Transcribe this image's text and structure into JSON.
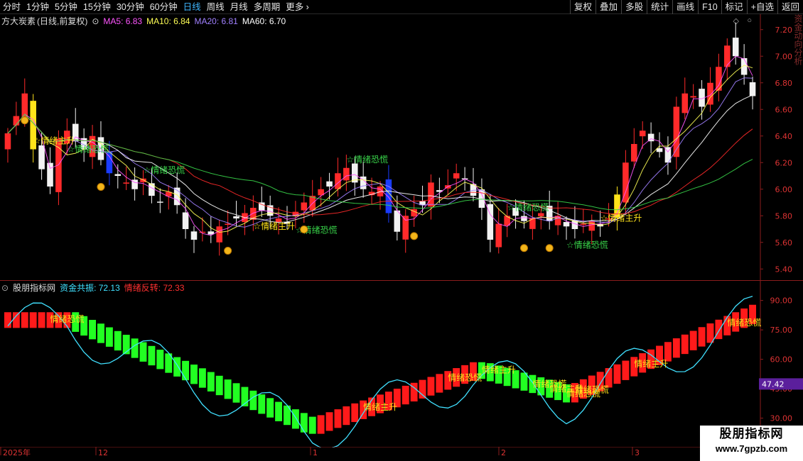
{
  "toolbar": {
    "periods": [
      "分时",
      "1分钟",
      "5分钟",
      "15分钟",
      "30分钟",
      "60分钟",
      "日线",
      "周线",
      "月线",
      "多周期",
      "更多 ›"
    ],
    "active_index": 6,
    "buttons": [
      "复权",
      "叠加",
      "多股",
      "统计",
      "画线",
      "F10",
      "标记",
      "+自选",
      "返回"
    ]
  },
  "main_chart": {
    "stock_name": "方大炭素",
    "mode": "(日线,前复权)",
    "ma": [
      {
        "label": "MA5:",
        "value": "6.83",
        "color": "#ff55ff"
      },
      {
        "label": "MA10:",
        "value": "6.84",
        "color": "#ffff55"
      },
      {
        "label": "MA20:",
        "value": "6.81",
        "color": "#a080ff"
      },
      {
        "label": "MA60:",
        "value": "6.70",
        "color": "#ffffff"
      }
    ],
    "y_ticks": [
      "7.20",
      "7.00",
      "6.80",
      "6.60",
      "6.40",
      "6.20",
      "6.00",
      "5.80",
      "5.60",
      "5.40"
    ],
    "signal_labels": [
      "情绪主升",
      "情绪恐慌",
      "情绪恐慌",
      "情绪主升",
      "情绪恐慌",
      "情绪恐慌",
      "情绪恐慌",
      "情绪恐慌",
      "情绪主升"
    ]
  },
  "indicator": {
    "name": "股朋指标网",
    "series": [
      {
        "label": "资金共振:",
        "value": "72.13",
        "color": "#40e0ff"
      },
      {
        "label": "情绪反转:",
        "value": "72.33",
        "color": "#ff3030"
      }
    ],
    "y_ticks": [
      "90.00",
      "75.00",
      "60.00",
      "45.00",
      "30.00"
    ],
    "current_value": "47.42",
    "labels": [
      "情绪恐慌",
      "情绪主升",
      "情绪恐慌",
      "情绪主升",
      "情绪恐慌",
      "情绪主升",
      "情绪恐慌",
      "情绪恐慌",
      "情绪主升",
      "情绪恐慌"
    ]
  },
  "time_axis": {
    "labels": [
      "2025年",
      "12",
      "1",
      "2",
      "3"
    ]
  },
  "watermark": {
    "title": "股朋指标网",
    "url": "www.7gpzb.com"
  },
  "side_text": "资金动向分析"
}
